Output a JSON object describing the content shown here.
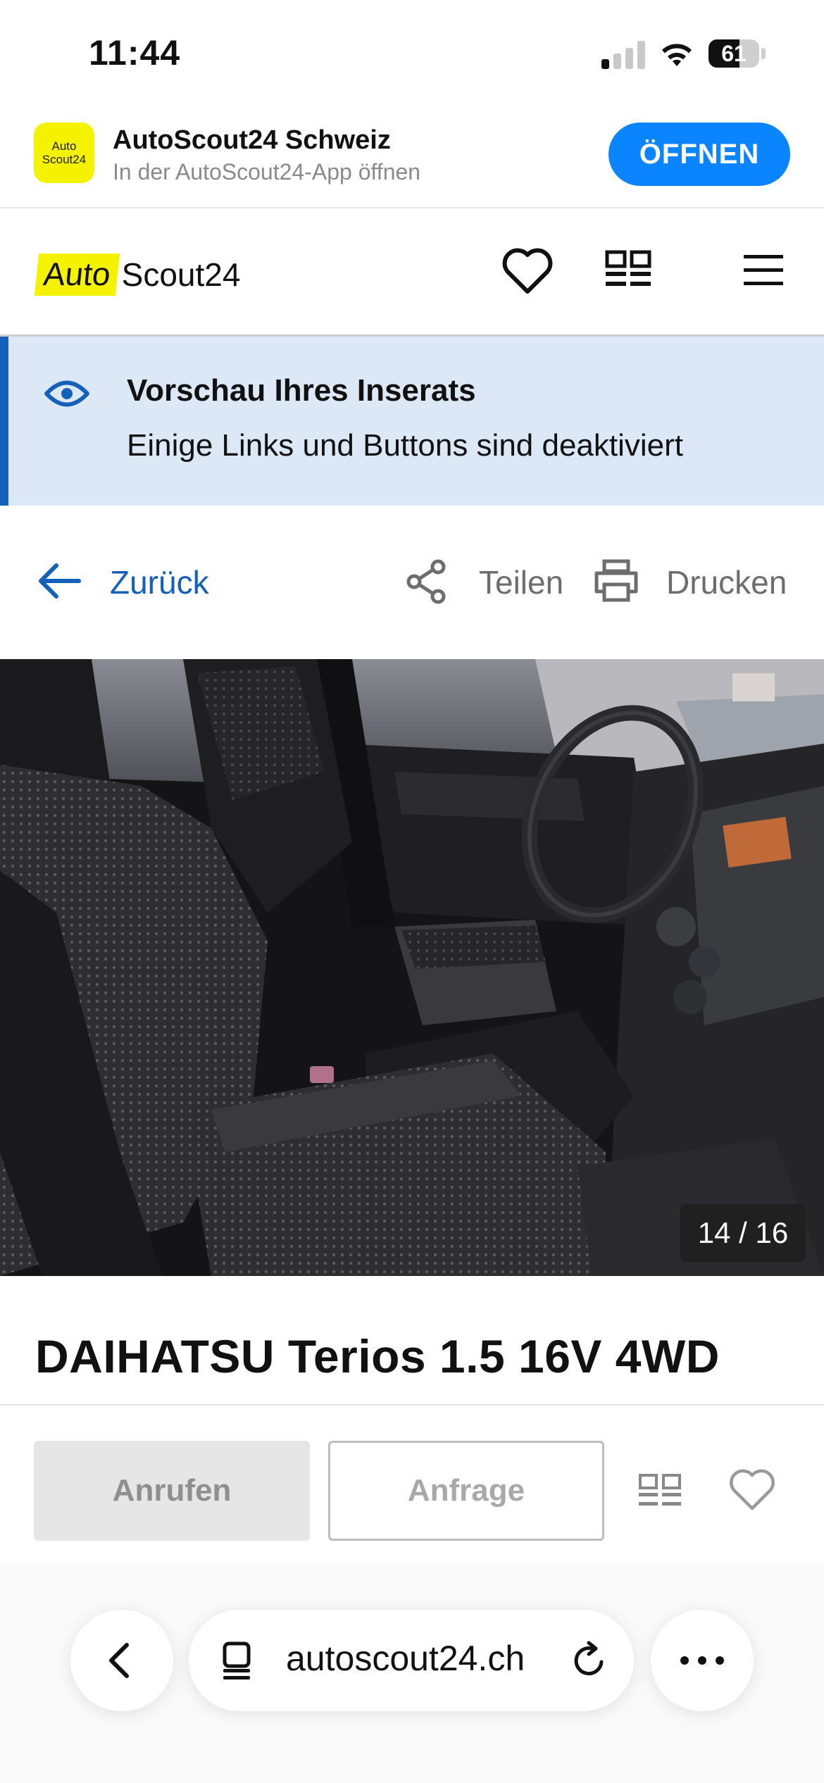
{
  "status_bar": {
    "time": "11:44",
    "battery_level": "61",
    "battery_fraction": 0.61
  },
  "app_banner": {
    "icon_line1": "Auto",
    "icon_line2": "Scout24",
    "app_name": "AutoScout24 Schweiz",
    "subtitle": "In der AutoScout24-App öffnen",
    "open_label": "ÖFFNEN",
    "accent_color": "#0a84ff"
  },
  "header": {
    "logo_part1": "Auto",
    "logo_part2": "Scout24",
    "logo_color": "#f5f200"
  },
  "preview_notice": {
    "title": "Vorschau Ihres Inserats",
    "text": "Einige Links und Buttons sind deaktiviert",
    "accent_color": "#1560b8"
  },
  "actions": {
    "back_label": "Zurück",
    "share_label": "Teilen",
    "print_label": "Drucken"
  },
  "gallery": {
    "counter": "14 / 16"
  },
  "listing": {
    "title": "DAIHATSU Terios 1.5 16V 4WD"
  },
  "contact": {
    "call_label": "Anrufen",
    "inquiry_label": "Anfrage"
  },
  "browser": {
    "url": "autoscout24.ch"
  },
  "icons": {
    "header": [
      "heart-icon",
      "compare-icon",
      "menu-icon"
    ],
    "preview": "eye-icon",
    "actions": [
      "arrow-left-icon",
      "share-icon",
      "printer-icon"
    ],
    "contact_row": [
      "compare-icon",
      "heart-icon"
    ],
    "browser": [
      "chevron-left-icon",
      "page-icon",
      "reload-icon",
      "more-icon"
    ]
  }
}
